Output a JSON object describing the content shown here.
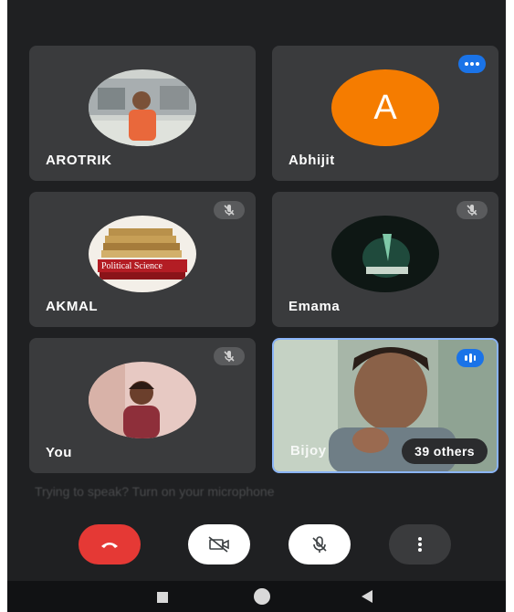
{
  "participants": [
    {
      "name": "AROTRIK",
      "status": "none"
    },
    {
      "name": "Abhijit",
      "avatar_letter": "A",
      "avatar_color": "#f57c00",
      "status": "speaking"
    },
    {
      "name": "AKMAL",
      "status": "muted",
      "photo_caption": "Political Science"
    },
    {
      "name": "Emama",
      "status": "muted"
    },
    {
      "name": "You",
      "status": "muted"
    },
    {
      "name": "Bijoy",
      "status": "speaking",
      "overflow_label": "39 others"
    }
  ],
  "hint": "Trying to speak? Turn on your microphone",
  "controls": {
    "end_call_color": "#e53935",
    "camera": "camera-off-icon",
    "mic": "mic-off-icon",
    "more": "more-vert-icon"
  },
  "colors": {
    "background": "#1f2022",
    "tile": "#3a3b3d",
    "accent": "#1a73e8"
  }
}
